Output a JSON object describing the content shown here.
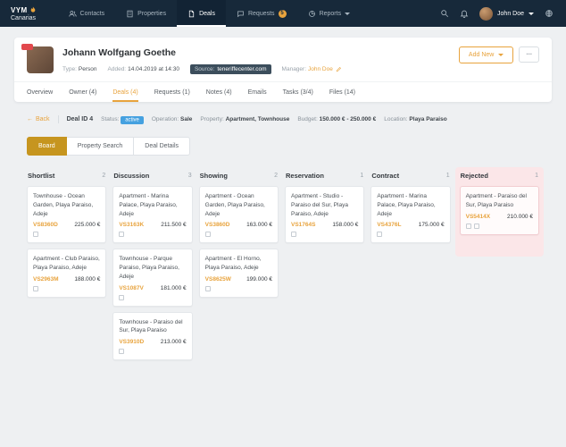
{
  "colors": {
    "navbar_bg": "#17293A",
    "accent_orange": "#E8A33D",
    "board_button_gold": "#C6951F",
    "status_active_blue": "#45A1E0",
    "rejected_pink": "#FBE6E8",
    "badge_red": "#E2484D"
  },
  "navbar": {
    "logo_line1": "VYM",
    "logo_line2": "Canarias",
    "items": [
      {
        "label": "Contacts"
      },
      {
        "label": "Properties"
      },
      {
        "label": "Deals"
      },
      {
        "label": "Requests",
        "badge": "5"
      },
      {
        "label": "Reports"
      }
    ],
    "user_name": "John Doe"
  },
  "contact": {
    "name": "Johann Wolfgang Goethe",
    "meta": [
      {
        "label": "Type:",
        "value": "Person"
      },
      {
        "label": "Added:",
        "value": "14.04.2019 at 14:30"
      },
      {
        "label": "Source:",
        "value": "teneriffecenter.com"
      },
      {
        "label": "Manager:",
        "value": "John Doe"
      }
    ],
    "add_new_label": "Add New",
    "more_label": "..."
  },
  "tabs": [
    {
      "label": "Overview"
    },
    {
      "label": "Owner (4)"
    },
    {
      "label": "Deals (4)"
    },
    {
      "label": "Requests (1)"
    },
    {
      "label": "Notes (4)"
    },
    {
      "label": "Emails"
    },
    {
      "label": "Tasks (3/4)"
    },
    {
      "label": "Files (14)"
    }
  ],
  "deal_bar": {
    "back_label": "Back",
    "deal_id": "Deal ID 4",
    "status_label": "Status:",
    "status_value": "active",
    "operation_label": "Operation:",
    "operation_value": "Sale",
    "property_label": "Property:",
    "property_value": "Apartment, Townhouse",
    "budget_label": "Budget:",
    "budget_value": "150.000 € - 250.000 €",
    "location_label": "Location:",
    "location_value": "Playa Paraiso"
  },
  "view_toggle": [
    {
      "label": "Board"
    },
    {
      "label": "Property Search"
    },
    {
      "label": "Deal Details"
    }
  ],
  "board": {
    "columns": [
      {
        "title": "Shortlist",
        "count": "2",
        "cards": [
          {
            "title": "Townhouse - Ocean Garden, Playa Paraiso, Adeje",
            "code": "VS8360D",
            "price": "225.000 €"
          },
          {
            "title": "Apartment - Club Paraiso, Playa Paraiso, Adeje",
            "code": "VS2963M",
            "price": "188.000 €"
          }
        ]
      },
      {
        "title": "Discussion",
        "count": "3",
        "cards": [
          {
            "title": "Apartment - Marina Palace, Playa Paraiso, Adeje",
            "code": "VS3163K",
            "price": "211.500 €"
          },
          {
            "title": "Townhouse - Parque Paraiso, Playa Paraiso, Adeje",
            "code": "VS1087V",
            "price": "181.000 €"
          },
          {
            "title": "Townhouse - Paraiso del Sur, Playa Paraiso",
            "code": "VS3910D",
            "price": "213.000 €"
          }
        ]
      },
      {
        "title": "Showing",
        "count": "2",
        "cards": [
          {
            "title": "Apartment - Ocean Garden, Playa Paraiso, Adeje",
            "code": "VS3860D",
            "price": "163.000 €"
          },
          {
            "title": "Apartment - El Horno, Playa Paraiso, Adeje",
            "code": "VS8625W",
            "price": "199.000 €"
          }
        ]
      },
      {
        "title": "Reservation",
        "count": "1",
        "cards": [
          {
            "title": "Apartment - Studio - Paraiso del Sur, Playa Paraiso, Adeje",
            "code": "VS1764S",
            "price": "158.000 €"
          }
        ]
      },
      {
        "title": "Contract",
        "count": "1",
        "cards": [
          {
            "title": "Apartment - Marina Palace, Playa Paraiso, Adeje",
            "code": "VS4376L",
            "price": "175.000 €"
          }
        ]
      },
      {
        "title": "Rejected",
        "count": "1",
        "cards": [
          {
            "title": "Apartment - Paraiso del Sur, Playa Paraiso",
            "code": "VS5414X",
            "price": "210.000 €"
          }
        ]
      }
    ]
  }
}
